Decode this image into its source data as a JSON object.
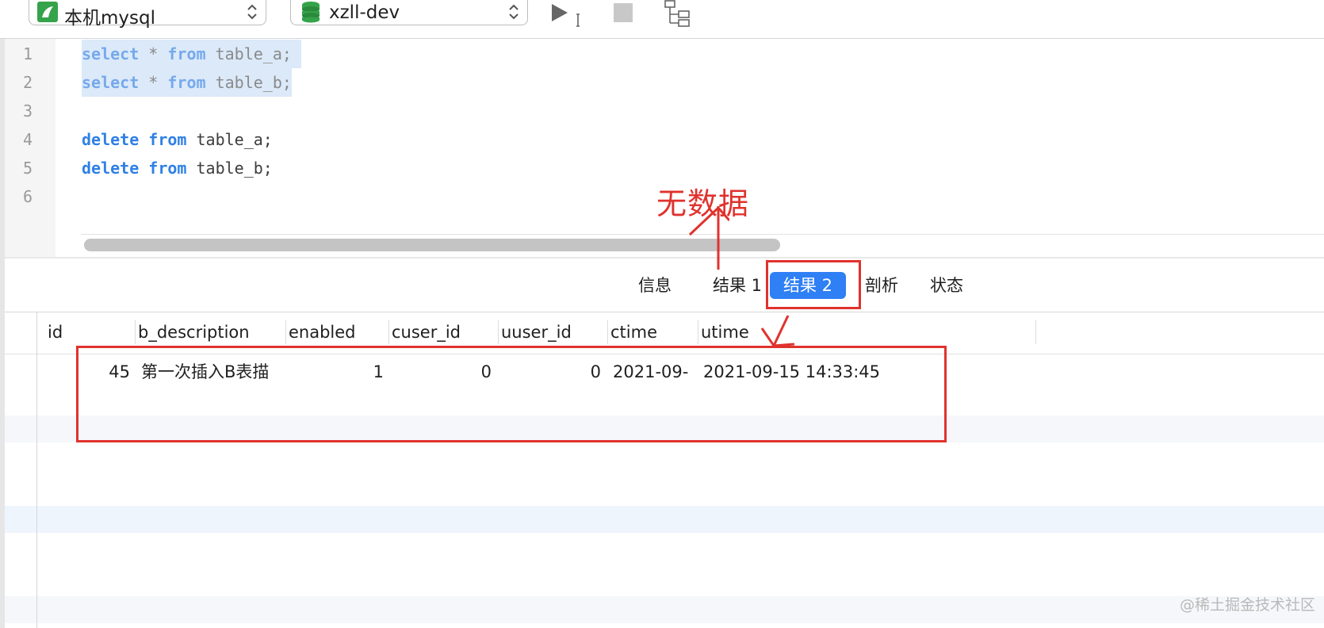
{
  "toolbar": {
    "connection": "本机mysql",
    "database": "xzll-dev",
    "run_icon": "play-icon",
    "stop_icon": "stop-icon",
    "explain_icon": "tree-icon"
  },
  "editor": {
    "line_numbers": [
      "1",
      "2",
      "3",
      "4",
      "5",
      "6"
    ],
    "lines": [
      {
        "kw1": "select",
        "mid": " * ",
        "kw2": "from",
        "rest": " table_a;"
      },
      {
        "kw1": "select",
        "mid": " * ",
        "kw2": "from",
        "rest": " table_b;"
      },
      {
        "kw1": "",
        "mid": "",
        "kw2": "",
        "rest": ""
      },
      {
        "kw1": "delete",
        "mid": " ",
        "kw2": "from",
        "rest": " table_a;"
      },
      {
        "kw1": "delete",
        "mid": " ",
        "kw2": "from",
        "rest": " table_b;"
      }
    ]
  },
  "annotation": {
    "no_data": "无数据"
  },
  "tabs": [
    "信息",
    "结果 1",
    "结果 2",
    "剖析",
    "状态"
  ],
  "active_tab": "结果 2",
  "grid": {
    "columns": [
      "id",
      "b_description",
      "enabled",
      "cuser_id",
      "uuser_id",
      "ctime",
      "utime"
    ],
    "rows": [
      [
        "45",
        "第一次插入B表描",
        "1",
        "0",
        "0",
        "2021-09-",
        "2021-09-15 14:33:45"
      ]
    ]
  },
  "watermark": "@稀土掘金技术社区",
  "colors": {
    "accent": "#2f7ff5",
    "annotation_red": "#e0322d",
    "keyword_blue": "#2f80e4"
  }
}
